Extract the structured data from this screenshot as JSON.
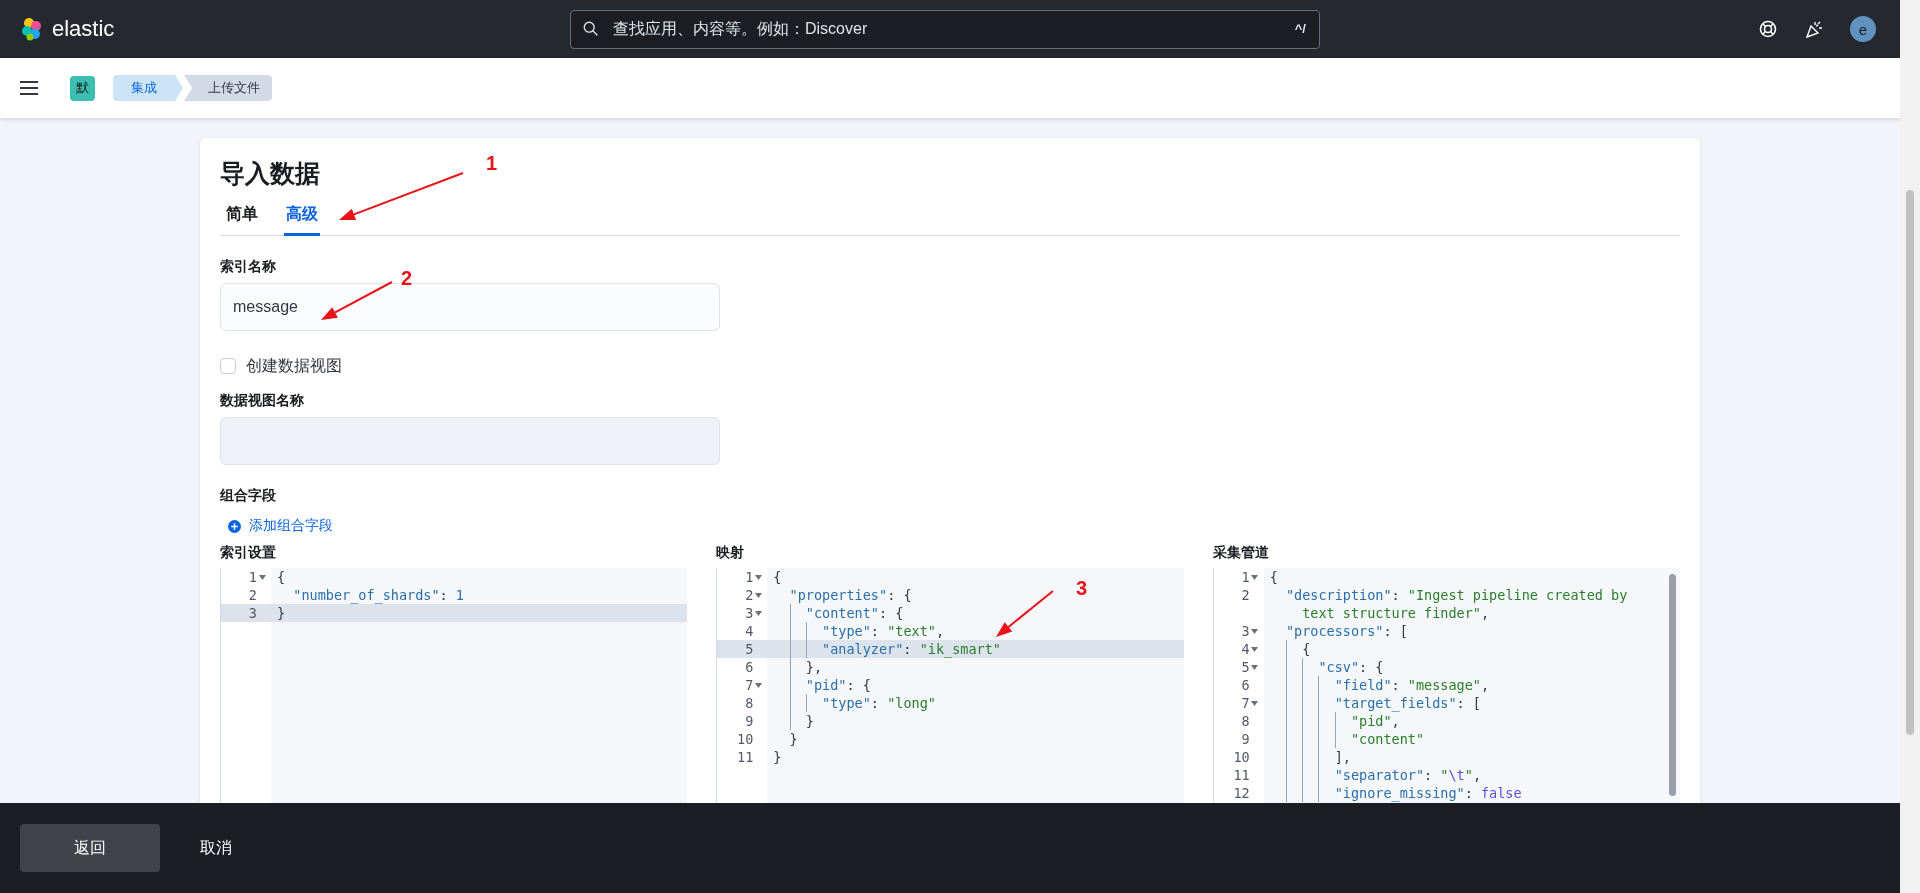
{
  "header": {
    "logo_text": "elastic",
    "search": {
      "placeholder": "查找应用、内容等。例如：Discover",
      "shortcut": "^/"
    },
    "avatar": "e"
  },
  "nav": {
    "space_badge": "默",
    "breadcrumbs": [
      {
        "label": "集成",
        "selected": false
      },
      {
        "label": "上传文件",
        "selected": true
      }
    ]
  },
  "page": {
    "title": "导入数据",
    "tabs": [
      {
        "label": "简单",
        "selected": false
      },
      {
        "label": "高级",
        "selected": true
      }
    ],
    "index_name": {
      "label": "索引名称",
      "value": "message"
    },
    "create_data_view": {
      "label": "创建数据视图",
      "checked": false
    },
    "data_view_name": {
      "label": "数据视图名称",
      "disabled": true
    },
    "combined_fields": {
      "label": "组合字段",
      "add_link": "添加组合字段"
    },
    "editors": [
      {
        "label": "索引设置",
        "scrollbar": false,
        "lines": [
          {
            "number": "1",
            "fold": true,
            "active": false,
            "tokens": [
              {
                "kind": "punct",
                "text": "{"
              }
            ]
          },
          {
            "number": "2",
            "fold": false,
            "active": false,
            "tokens": [
              {
                "kind": "key",
                "text": "  \"number_of_shards\""
              },
              {
                "kind": "punct",
                "text": ": "
              },
              {
                "kind": "number",
                "text": "1"
              }
            ]
          },
          {
            "number": "3",
            "fold": false,
            "active": true,
            "tokens": [
              {
                "kind": "punct",
                "text": "}"
              }
            ]
          }
        ]
      },
      {
        "label": "映射",
        "scrollbar": false,
        "lines": [
          {
            "number": "1",
            "fold": true,
            "active": false,
            "tokens": [
              {
                "kind": "punct",
                "text": "{"
              }
            ]
          },
          {
            "number": "2",
            "fold": true,
            "active": false,
            "tokens": [
              {
                "kind": "key",
                "text": "  \"properties\""
              },
              {
                "kind": "punct",
                "text": ": {"
              }
            ]
          },
          {
            "number": "3",
            "fold": true,
            "active": false,
            "tokens": [
              {
                "kind": "key",
                "text": "    \"content\""
              },
              {
                "kind": "punct",
                "text": ": {"
              }
            ]
          },
          {
            "number": "4",
            "fold": false,
            "active": false,
            "tokens": [
              {
                "kind": "key",
                "text": "      \"type\""
              },
              {
                "kind": "punct",
                "text": ": "
              },
              {
                "kind": "string",
                "text": "\"text\""
              },
              {
                "kind": "punct",
                "text": ","
              }
            ]
          },
          {
            "number": "5",
            "fold": false,
            "active": true,
            "tokens": [
              {
                "kind": "key",
                "text": "      \"analyzer\""
              },
              {
                "kind": "punct",
                "text": ": "
              },
              {
                "kind": "string",
                "text": "\"ik_smart\""
              }
            ]
          },
          {
            "number": "6",
            "fold": false,
            "active": false,
            "tokens": [
              {
                "kind": "punct",
                "text": "    },"
              }
            ]
          },
          {
            "number": "7",
            "fold": true,
            "active": false,
            "tokens": [
              {
                "kind": "key",
                "text": "    \"pid\""
              },
              {
                "kind": "punct",
                "text": ": {"
              }
            ]
          },
          {
            "number": "8",
            "fold": false,
            "active": false,
            "tokens": [
              {
                "kind": "key",
                "text": "      \"type\""
              },
              {
                "kind": "punct",
                "text": ": "
              },
              {
                "kind": "string",
                "text": "\"long\""
              }
            ]
          },
          {
            "number": "9",
            "fold": false,
            "active": false,
            "tokens": [
              {
                "kind": "punct",
                "text": "    }"
              }
            ]
          },
          {
            "number": "10",
            "fold": false,
            "active": false,
            "tokens": [
              {
                "kind": "punct",
                "text": "  }"
              }
            ]
          },
          {
            "number": "11",
            "fold": false,
            "active": false,
            "tokens": [
              {
                "kind": "punct",
                "text": "}"
              }
            ]
          }
        ]
      },
      {
        "label": "采集管道",
        "scrollbar": true,
        "lines": [
          {
            "number": "1",
            "fold": true,
            "active": false,
            "tokens": [
              {
                "kind": "punct",
                "text": "{"
              }
            ]
          },
          {
            "number": "2",
            "fold": false,
            "active": false,
            "tokens": [
              {
                "kind": "key",
                "text": "  \"description\""
              },
              {
                "kind": "punct",
                "text": ": "
              },
              {
                "kind": "string",
                "text": "\"Ingest pipeline created by text structure finder\""
              },
              {
                "kind": "punct",
                "text": ","
              }
            ]
          },
          {
            "number": "3",
            "fold": true,
            "active": false,
            "tokens": [
              {
                "kind": "key",
                "text": "  \"processors\""
              },
              {
                "kind": "punct",
                "text": ": ["
              }
            ]
          },
          {
            "number": "4",
            "fold": true,
            "active": false,
            "tokens": [
              {
                "kind": "punct",
                "text": "    {"
              }
            ]
          },
          {
            "number": "5",
            "fold": true,
            "active": false,
            "tokens": [
              {
                "kind": "key",
                "text": "      \"csv\""
              },
              {
                "kind": "punct",
                "text": ": {"
              }
            ]
          },
          {
            "number": "6",
            "fold": false,
            "active": false,
            "tokens": [
              {
                "kind": "key",
                "text": "        \"field\""
              },
              {
                "kind": "punct",
                "text": ": "
              },
              {
                "kind": "string",
                "text": "\"message\""
              },
              {
                "kind": "punct",
                "text": ","
              }
            ]
          },
          {
            "number": "7",
            "fold": true,
            "active": false,
            "tokens": [
              {
                "kind": "key",
                "text": "        \"target_fields\""
              },
              {
                "kind": "punct",
                "text": ": ["
              }
            ]
          },
          {
            "number": "8",
            "fold": false,
            "active": false,
            "tokens": [
              {
                "kind": "string",
                "text": "          \"pid\""
              },
              {
                "kind": "punct",
                "text": ","
              }
            ]
          },
          {
            "number": "9",
            "fold": false,
            "active": false,
            "tokens": [
              {
                "kind": "string",
                "text": "          \"content\""
              }
            ]
          },
          {
            "number": "10",
            "fold": false,
            "active": false,
            "tokens": [
              {
                "kind": "punct",
                "text": "        ],"
              }
            ]
          },
          {
            "number": "11",
            "fold": false,
            "active": false,
            "tokens": [
              {
                "kind": "key",
                "text": "        \"separator\""
              },
              {
                "kind": "punct",
                "text": ": "
              },
              {
                "kind": "string",
                "text": "\""
              },
              {
                "kind": "escape",
                "text": "\\t"
              },
              {
                "kind": "string",
                "text": "\""
              },
              {
                "kind": "punct",
                "text": ","
              }
            ]
          },
          {
            "number": "12",
            "fold": false,
            "active": false,
            "tokens": [
              {
                "kind": "key",
                "text": "        \"ignore_missing\""
              },
              {
                "kind": "punct",
                "text": ": "
              },
              {
                "kind": "boolean",
                "text": "false"
              }
            ]
          }
        ]
      }
    ]
  },
  "footer": {
    "buttons": [
      {
        "label": "返回",
        "kind": "filled"
      },
      {
        "label": "取消",
        "kind": "empty"
      }
    ]
  },
  "annotations": [
    {
      "label": "1"
    },
    {
      "label": "2"
    },
    {
      "label": "3"
    }
  ]
}
